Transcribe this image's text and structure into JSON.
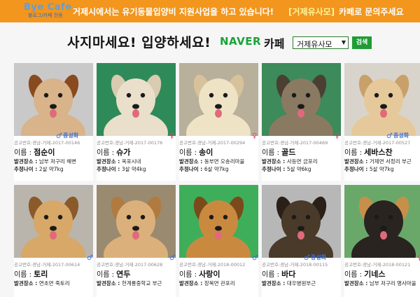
{
  "topbar": {
    "logo_text": "Bye Cafe",
    "logo_sub": "블로그/카페 전용",
    "message": "거제시에서는 유기동물입양비 지원사업을 하고 있습니다!",
    "cafe_name": "[거제유사모]",
    "message_tail": "카페로 문의주세요"
  },
  "header": {
    "headline": "사지마세요! 입양하세요!",
    "naver": "NAVER",
    "cafe_word": "카페",
    "select_value": "거제유사모",
    "search_label": "검색"
  },
  "labels": {
    "name": "이름 : ",
    "place": "발견장소 : ",
    "age": "추정나이 : ",
    "neuter": "중성화"
  },
  "cards": [
    {
      "notice": "공고번호:경남-거제-2017-00146",
      "name": "점순이",
      "place": "남부 저구리 해변",
      "age": "2살 약7kg",
      "gender": "male",
      "gender_symbol": "♂",
      "neutered": true,
      "fur": "#d9b48a",
      "ear": "#8a4a1f",
      "bg": "#c9c9c9"
    },
    {
      "notice": "공고번호:경남-거제-2017-00176",
      "name": "슈가",
      "place": "옥포시내",
      "age": "3살 약4kg",
      "gender": "female",
      "gender_symbol": "♀",
      "neutered": false,
      "fur": "#eadfca",
      "ear": "#d9cbb0",
      "bg": "#2f8a5a"
    },
    {
      "notice": "공고번호:경남-거제-2017-00294",
      "name": "송이",
      "place": "동부면 오송리마을",
      "age": "6살 약7kg",
      "gender": "female",
      "gender_symbol": "♀",
      "neutered": false,
      "fur": "#efe3c6",
      "ear": "#d7c29c",
      "bg": "#b8b09a"
    },
    {
      "notice": "공고번호:경남-거제-2017-00469",
      "name": "골드",
      "place": "사등면 금포리",
      "age": "5살 약6kg",
      "gender": "female",
      "gender_symbol": "♀",
      "neutered": false,
      "fur": "#8a7a62",
      "ear": "#4a3f32",
      "bg": "#3d8a5a"
    },
    {
      "notice": "공고번호:경남-거제-2017-00527",
      "name": "세바스찬",
      "place": "거제면 서정리 부근",
      "age": "5살 약7kg",
      "gender": "male",
      "gender_symbol": "♂",
      "neutered": true,
      "fur": "#e6c99a",
      "ear": "#c9a06a",
      "bg": "#d8d4cc"
    },
    {
      "notice": "공고번호:경남-거제-2017-00614",
      "name": "토리",
      "place": "연초면 죽토리",
      "age": "",
      "gender": "male",
      "gender_symbol": "♂",
      "neutered": false,
      "fur": "#d8a868",
      "ear": "#8a5a2a",
      "bg": "#b9b5ad"
    },
    {
      "notice": "공고번호:경남-거제-2017-00628",
      "name": "연두",
      "place": "헌계룡중학교 부근",
      "age": "",
      "gender": "male",
      "gender_symbol": "♂",
      "neutered": false,
      "fur": "#dcb07a",
      "ear": "#b07a40",
      "bg": "#9a8a70"
    },
    {
      "notice": "공고번호:경남-거제-2018-00012",
      "name": "사랑이",
      "place": "장목면 관포리",
      "age": "",
      "gender": "male",
      "gender_symbol": "♂",
      "neutered": false,
      "fur": "#c98a40",
      "ear": "#7a4a1a",
      "bg": "#3fae5a"
    },
    {
      "notice": "공고번호:경남-거제-2018-00115",
      "name": "바다",
      "place": "대우병원부근",
      "age": "",
      "gender": "male",
      "gender_symbol": "♂",
      "neutered": true,
      "fur": "#4a3a2a",
      "ear": "#2a2018",
      "bg": "#b7b7b7"
    },
    {
      "notice": "공고번호:경남-거제-2018-00121",
      "name": "기네스",
      "place": "남부 저구리 명사마을",
      "age": "",
      "gender": "female",
      "gender_symbol": "♀",
      "neutered": false,
      "fur": "#2a2420",
      "ear": "#c7904a",
      "bg": "#6aa86a"
    }
  ]
}
